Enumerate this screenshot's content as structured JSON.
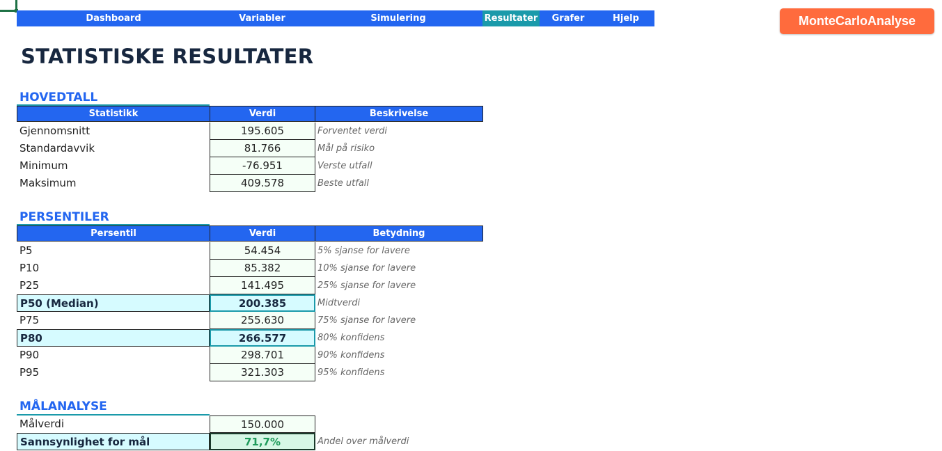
{
  "nav": {
    "items": [
      {
        "label": "Dashboard",
        "active": false
      },
      {
        "label": "Variabler",
        "active": false
      },
      {
        "label": "Simulering",
        "active": false
      },
      {
        "label": "Resultater",
        "active": true
      },
      {
        "label": "Grafer",
        "active": false
      },
      {
        "label": "Hjelp",
        "active": false
      }
    ]
  },
  "brand": {
    "label": "MonteCarloAnalyse"
  },
  "page_title": "STATISTISKE RESULTATER",
  "hovedtall": {
    "title": "HOVEDTALL",
    "headers": [
      "Statistikk",
      "Verdi",
      "Beskrivelse"
    ],
    "rows": [
      {
        "label": "Gjennomsnitt",
        "value": "195.605",
        "desc": "Forventet verdi"
      },
      {
        "label": "Standardavvik",
        "value": "81.766",
        "desc": "Mål på risiko"
      },
      {
        "label": "Minimum",
        "value": "-76.951",
        "desc": "Verste utfall"
      },
      {
        "label": "Maksimum",
        "value": "409.578",
        "desc": "Beste utfall"
      }
    ]
  },
  "persentiler": {
    "title": "PERSENTILER",
    "headers": [
      "Persentil",
      "Verdi",
      "Betydning"
    ],
    "rows": [
      {
        "label": "P5",
        "value": "54.454",
        "desc": "5% sjanse for lavere"
      },
      {
        "label": "P10",
        "value": "85.382",
        "desc": "10% sjanse for lavere"
      },
      {
        "label": "P25",
        "value": "141.495",
        "desc": "25% sjanse for lavere"
      },
      {
        "label": "P50 (Median)",
        "value": "200.385",
        "desc": "Midtverdi"
      },
      {
        "label": "P75",
        "value": "255.630",
        "desc": "75% sjanse for lavere"
      },
      {
        "label": "P80",
        "value": "266.577",
        "desc": "80% konfidens"
      },
      {
        "label": "P90",
        "value": "298.701",
        "desc": "90% konfidens"
      },
      {
        "label": "P95",
        "value": "321.303",
        "desc": "95% konfidens"
      }
    ]
  },
  "malanalyse": {
    "title": "MÅLANALYSE",
    "rows": [
      {
        "label": "Målverdi",
        "value": "150.000",
        "desc": ""
      },
      {
        "label": "Sannsynlighet for mål",
        "value": "71,7%",
        "desc": "Andel over målverdi"
      }
    ]
  },
  "colors": {
    "nav_bg": "#2366f0",
    "nav_active": "#1a9aaa",
    "brand_bg": "#ff6b3d",
    "highlight_bg": "#d6fbff",
    "goal_value": "#1e9a5a"
  }
}
